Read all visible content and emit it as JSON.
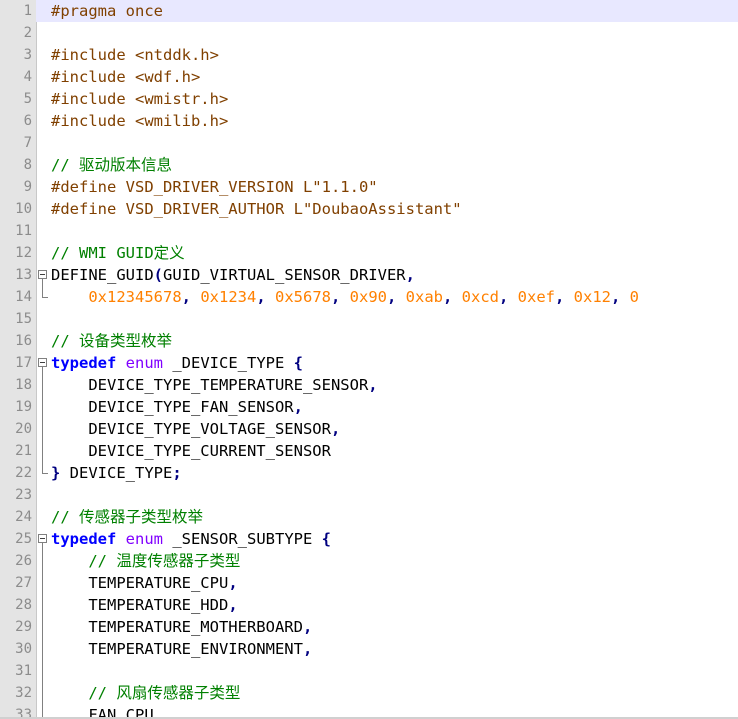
{
  "editor": {
    "current_line": 1,
    "lines": [
      {
        "n": "1",
        "tokens": [
          {
            "t": "pp",
            "v": "#pragma once"
          }
        ]
      },
      {
        "n": "2",
        "tokens": []
      },
      {
        "n": "3",
        "tokens": [
          {
            "t": "pp",
            "v": "#include <ntddk.h>"
          }
        ]
      },
      {
        "n": "4",
        "tokens": [
          {
            "t": "pp",
            "v": "#include <wdf.h>"
          }
        ]
      },
      {
        "n": "5",
        "tokens": [
          {
            "t": "pp",
            "v": "#include <wmistr.h>"
          }
        ]
      },
      {
        "n": "6",
        "tokens": [
          {
            "t": "pp",
            "v": "#include <wmilib.h>"
          }
        ]
      },
      {
        "n": "7",
        "tokens": []
      },
      {
        "n": "8",
        "tokens": [
          {
            "t": "cm",
            "v": "// 驱动版本信息"
          }
        ]
      },
      {
        "n": "9",
        "tokens": [
          {
            "t": "pp",
            "v": "#define VSD_DRIVER_VERSION L\"1.1.0\""
          }
        ]
      },
      {
        "n": "10",
        "tokens": [
          {
            "t": "pp",
            "v": "#define VSD_DRIVER_AUTHOR L\"DoubaoAssistant\""
          }
        ]
      },
      {
        "n": "11",
        "tokens": []
      },
      {
        "n": "12",
        "tokens": [
          {
            "t": "cm",
            "v": "// WMI GUID定义"
          }
        ]
      },
      {
        "n": "13",
        "fold": "start",
        "tokens": [
          {
            "t": "txt",
            "v": "DEFINE_GUID"
          },
          {
            "t": "op",
            "v": "("
          },
          {
            "t": "txt",
            "v": "GUID_VIRTUAL_SENSOR_DRIVER"
          },
          {
            "t": "op",
            "v": ","
          }
        ]
      },
      {
        "n": "14",
        "fold": "end",
        "tokens": [
          {
            "t": "txt",
            "v": "    "
          },
          {
            "t": "num",
            "v": "0x12345678"
          },
          {
            "t": "op",
            "v": ", "
          },
          {
            "t": "num",
            "v": "0x1234"
          },
          {
            "t": "op",
            "v": ", "
          },
          {
            "t": "num",
            "v": "0x5678"
          },
          {
            "t": "op",
            "v": ", "
          },
          {
            "t": "num",
            "v": "0x90"
          },
          {
            "t": "op",
            "v": ", "
          },
          {
            "t": "num",
            "v": "0xab"
          },
          {
            "t": "op",
            "v": ", "
          },
          {
            "t": "num",
            "v": "0xcd"
          },
          {
            "t": "op",
            "v": ", "
          },
          {
            "t": "num",
            "v": "0xef"
          },
          {
            "t": "op",
            "v": ", "
          },
          {
            "t": "num",
            "v": "0x12"
          },
          {
            "t": "op",
            "v": ", "
          },
          {
            "t": "num",
            "v": "0"
          }
        ]
      },
      {
        "n": "15",
        "tokens": []
      },
      {
        "n": "16",
        "tokens": [
          {
            "t": "cm",
            "v": "// 设备类型枚举"
          }
        ]
      },
      {
        "n": "17",
        "fold": "start",
        "tokens": [
          {
            "t": "kw",
            "v": "typedef"
          },
          {
            "t": "txt",
            "v": " "
          },
          {
            "t": "ty",
            "v": "enum"
          },
          {
            "t": "txt",
            "v": " _DEVICE_TYPE "
          },
          {
            "t": "op",
            "v": "{"
          }
        ]
      },
      {
        "n": "18",
        "fold": "mid",
        "tokens": [
          {
            "t": "txt",
            "v": "    DEVICE_TYPE_TEMPERATURE_SENSOR"
          },
          {
            "t": "op",
            "v": ","
          }
        ]
      },
      {
        "n": "19",
        "fold": "mid",
        "tokens": [
          {
            "t": "txt",
            "v": "    DEVICE_TYPE_FAN_SENSOR"
          },
          {
            "t": "op",
            "v": ","
          }
        ]
      },
      {
        "n": "20",
        "fold": "mid",
        "tokens": [
          {
            "t": "txt",
            "v": "    DEVICE_TYPE_VOLTAGE_SENSOR"
          },
          {
            "t": "op",
            "v": ","
          }
        ]
      },
      {
        "n": "21",
        "fold": "mid",
        "tokens": [
          {
            "t": "txt",
            "v": "    DEVICE_TYPE_CURRENT_SENSOR"
          }
        ]
      },
      {
        "n": "22",
        "fold": "end",
        "tokens": [
          {
            "t": "op",
            "v": "}"
          },
          {
            "t": "txt",
            "v": " DEVICE_TYPE"
          },
          {
            "t": "op",
            "v": ";"
          }
        ]
      },
      {
        "n": "23",
        "tokens": []
      },
      {
        "n": "24",
        "tokens": [
          {
            "t": "cm",
            "v": "// 传感器子类型枚举"
          }
        ]
      },
      {
        "n": "25",
        "fold": "start",
        "tokens": [
          {
            "t": "kw",
            "v": "typedef"
          },
          {
            "t": "txt",
            "v": " "
          },
          {
            "t": "ty",
            "v": "enum"
          },
          {
            "t": "txt",
            "v": " _SENSOR_SUBTYPE "
          },
          {
            "t": "op",
            "v": "{"
          }
        ]
      },
      {
        "n": "26",
        "fold": "mid",
        "tokens": [
          {
            "t": "txt",
            "v": "    "
          },
          {
            "t": "cm",
            "v": "// 温度传感器子类型"
          }
        ]
      },
      {
        "n": "27",
        "fold": "mid",
        "tokens": [
          {
            "t": "txt",
            "v": "    TEMPERATURE_CPU"
          },
          {
            "t": "op",
            "v": ","
          }
        ]
      },
      {
        "n": "28",
        "fold": "mid",
        "tokens": [
          {
            "t": "txt",
            "v": "    TEMPERATURE_HDD"
          },
          {
            "t": "op",
            "v": ","
          }
        ]
      },
      {
        "n": "29",
        "fold": "mid",
        "tokens": [
          {
            "t": "txt",
            "v": "    TEMPERATURE_MOTHERBOARD"
          },
          {
            "t": "op",
            "v": ","
          }
        ]
      },
      {
        "n": "30",
        "fold": "mid",
        "tokens": [
          {
            "t": "txt",
            "v": "    TEMPERATURE_ENVIRONMENT"
          },
          {
            "t": "op",
            "v": ","
          }
        ]
      },
      {
        "n": "31",
        "fold": "mid",
        "tokens": []
      },
      {
        "n": "32",
        "fold": "mid",
        "tokens": [
          {
            "t": "txt",
            "v": "    "
          },
          {
            "t": "cm",
            "v": "// 风扇传感器子类型"
          }
        ]
      },
      {
        "n": "33",
        "fold": "mid",
        "tokens": [
          {
            "t": "txt",
            "v": "    FAN_CPU"
          }
        ]
      }
    ]
  }
}
